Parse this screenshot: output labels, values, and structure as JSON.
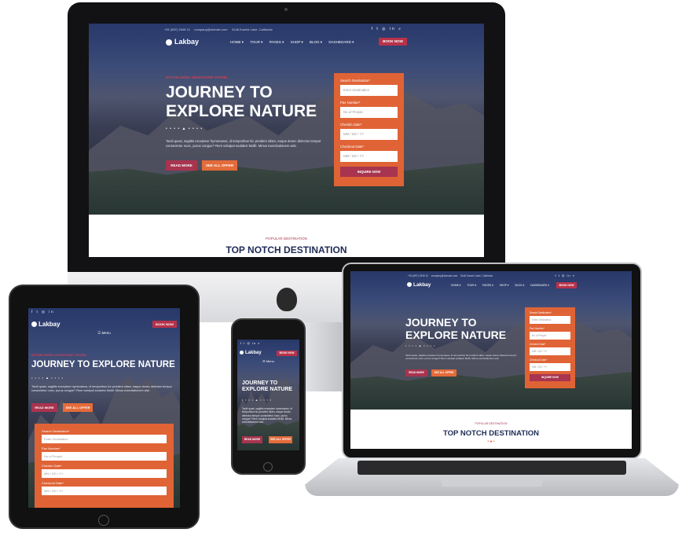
{
  "site": {
    "brand": "Lakbay",
    "phone": "+91 (897) 2949 12",
    "email": "company@domain.com",
    "address": "3146 Koontz Lane, California",
    "social_icons": [
      "facebook-icon",
      "twitter-icon",
      "instagram-icon",
      "linkedin-icon",
      "search-icon"
    ],
    "nav": [
      "HOME ▾",
      "TOUR ▾",
      "PAGES ▾",
      "SHOP ▾",
      "BLOG ▾",
      "DASHBOARD ▾"
    ],
    "book_now": "BOOK NOW",
    "menu_label": "☰ Menu"
  },
  "hero": {
    "kicker": "ESTABLISHED ADVENTURE TRAVEL",
    "title_line1": "JOURNEY TO",
    "title_line2": "EXPLORE NATURE",
    "title_one_line": "JOURNEY TO EXPLORE NATURE",
    "dots": "• • • • ▲ • • • •",
    "text": "Taciti quasi, sagittis excepteur hymenaeos, id temporibus hic proident ullam, eaque donec delectus tempor consectetur nunc, purus congue? Rem volutpat sodales! Mollit. Minus exercitationem wisi.",
    "read_more": "READ MORE",
    "see_all": "SEE ALL OFFER"
  },
  "form": {
    "search_label": "Search Destination*",
    "search_ph": "Enter Destination",
    "pax_label": "Pax Number*",
    "pax_ph": "No.of People",
    "checkin_label": "Checkin Date*",
    "checkin_ph": "MM / DD / YY",
    "checkout_label": "Checkout Date*",
    "checkout_ph": "MM / DD / YY",
    "submit": "INQUIRE NOW"
  },
  "section": {
    "kicker": "POPULAR DESTINATION",
    "title": "TOP NOTCH DESTINATION"
  },
  "colors": {
    "accent_red": "#a8344f",
    "accent_orange": "#e06336",
    "navy": "#1f2a55"
  }
}
